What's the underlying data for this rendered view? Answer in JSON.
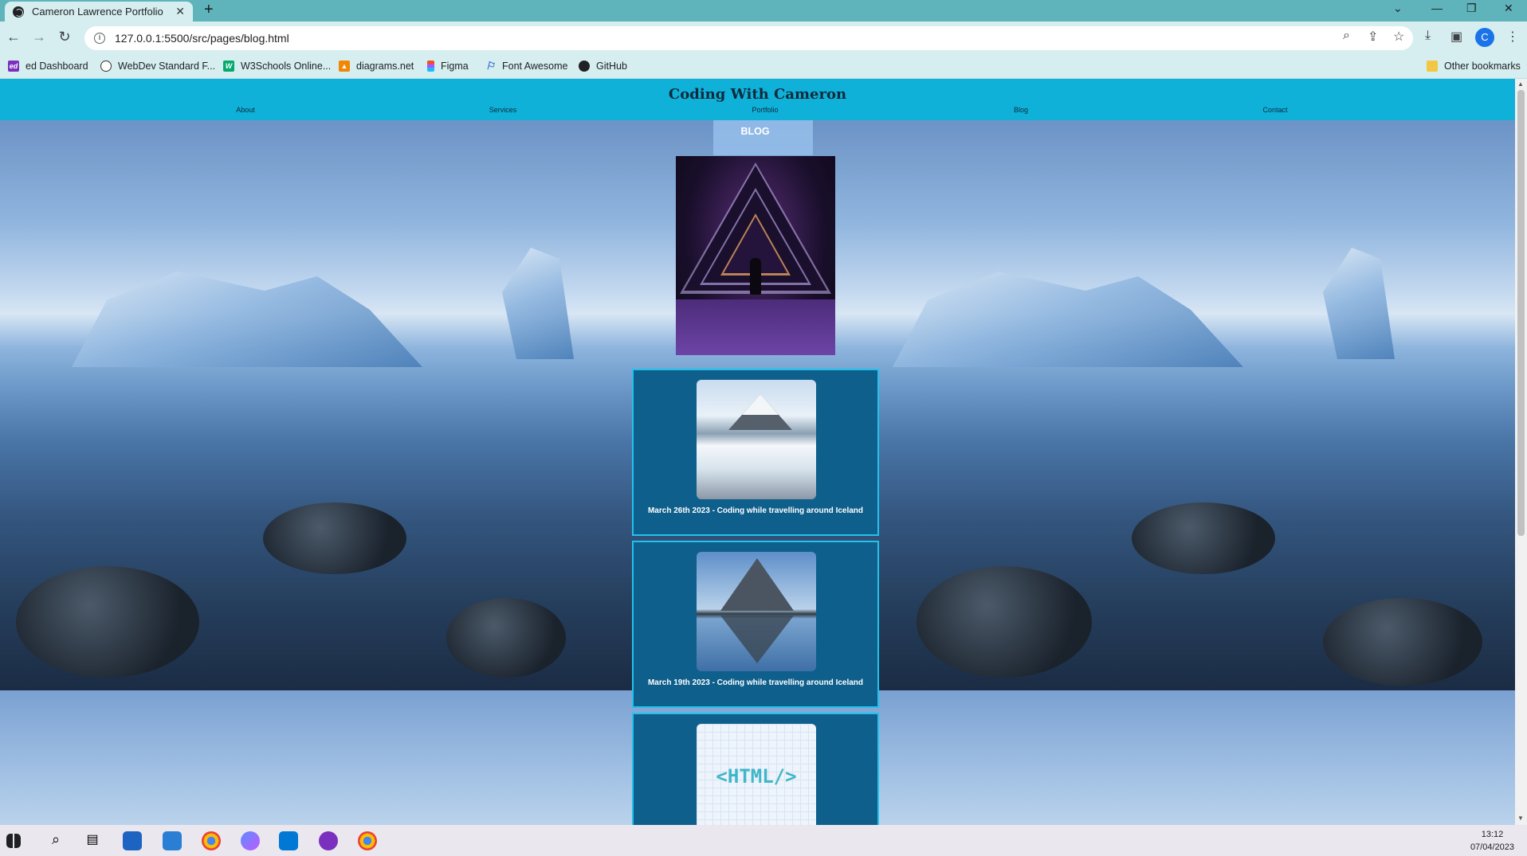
{
  "browser": {
    "tab_title": "Cameron Lawrence Portfolio",
    "tab_close": "✕",
    "new_tab": "+",
    "url": "127.0.0.1:5500/src/pages/blog.html",
    "avatar_letter": "C",
    "bookmarks": [
      "ed Dashboard",
      "WebDev Standard F...",
      "W3Schools Online...",
      "diagrams.net",
      "Figma",
      "Font Awesome",
      "GitHub"
    ],
    "other_bookmarks": "Other bookmarks"
  },
  "site": {
    "brand": "Coding With Cameron",
    "nav": [
      "About",
      "Services",
      "Portfolio",
      "Blog",
      "Contact"
    ],
    "page_heading": "BLOG",
    "posts": [
      {
        "caption": "March 26th 2023 - Coding while travelling around Iceland"
      },
      {
        "caption": "March 19th 2023 - Coding while travelling around Iceland"
      },
      {
        "caption": ""
      }
    ],
    "html_logo_text": "<HTML/>"
  },
  "taskbar": {
    "time": "13:12",
    "date": "07/04/2023"
  },
  "colors": {
    "header": "#10b1d8",
    "card": "#0e5f8c",
    "card_border": "#23c2ee",
    "tabstrip": "#5fb4bc",
    "toolbar": "#d6eef0"
  }
}
